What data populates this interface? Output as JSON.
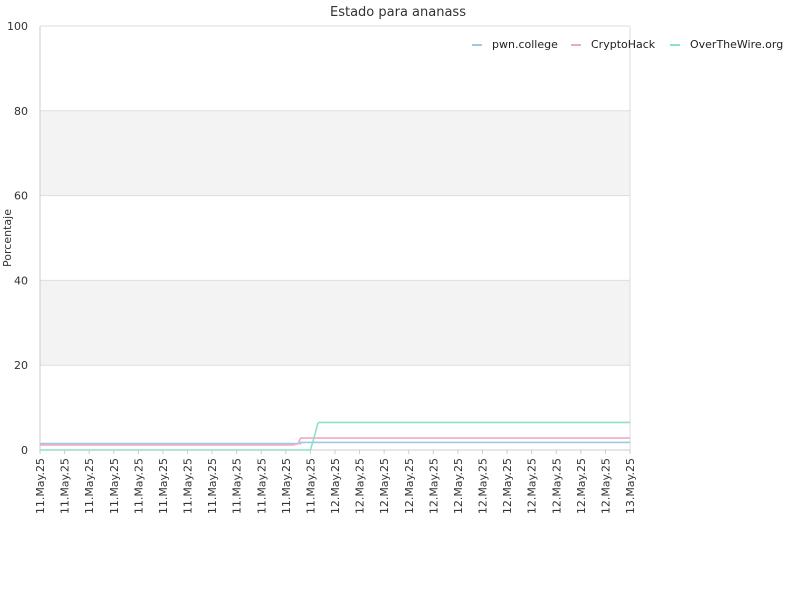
{
  "chart_data": {
    "type": "line",
    "title": "Estado para ananass",
    "xlabel": "",
    "ylabel": "Porcentaje",
    "ylim": [
      0,
      100
    ],
    "yticks": [
      0,
      20,
      40,
      60,
      80,
      100
    ],
    "x_tick_labels": [
      "11.May.25",
      "11.May.25",
      "11.May.25",
      "11.May.25",
      "11.May.25",
      "11.May.25",
      "11.May.25",
      "11.May.25",
      "11.May.25",
      "11.May.25",
      "11.May.25",
      "11.May.25",
      "12.May.25",
      "12.May.25",
      "12.May.25",
      "12.May.25",
      "12.May.25",
      "12.May.25",
      "12.May.25",
      "12.May.25",
      "12.May.25",
      "12.May.25",
      "12.May.25",
      "12.May.25",
      "13.May.25"
    ],
    "legend_position": "top-right",
    "grid": "horizontal bands",
    "series": [
      {
        "name": "pwn.college",
        "color": "#9ec9e6",
        "points": [
          [
            0,
            1.5
          ],
          [
            10.6,
            1.5
          ],
          [
            10.6,
            1.8
          ],
          [
            24,
            1.8
          ]
        ]
      },
      {
        "name": "CryptoHack",
        "color": "#f0aac2",
        "points": [
          [
            0,
            1.2
          ],
          [
            10.3,
            1.2
          ],
          [
            10.5,
            1.5
          ],
          [
            10.6,
            2.8
          ],
          [
            24,
            2.8
          ]
        ]
      },
      {
        "name": "OverTheWire.org",
        "color": "#8ee0c8",
        "points": [
          [
            0,
            0
          ],
          [
            11.0,
            0
          ],
          [
            11.1,
            2.0
          ],
          [
            11.2,
            4.0
          ],
          [
            11.3,
            6.2
          ],
          [
            11.35,
            6.5
          ],
          [
            24,
            6.5
          ]
        ]
      }
    ]
  }
}
